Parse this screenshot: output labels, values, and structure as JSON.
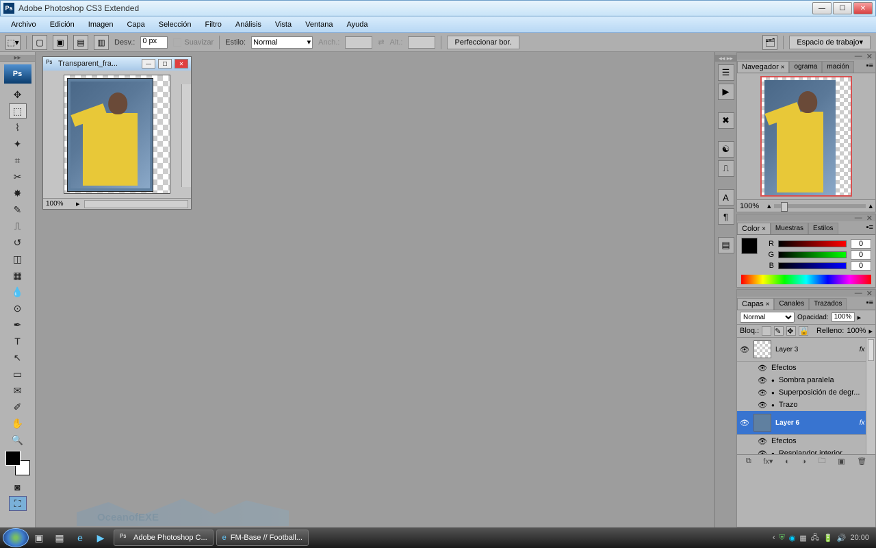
{
  "title": "Adobe Photoshop CS3 Extended",
  "menu": [
    "Archivo",
    "Edición",
    "Imagen",
    "Capa",
    "Selección",
    "Filtro",
    "Análisis",
    "Vista",
    "Ventana",
    "Ayuda"
  ],
  "optbar": {
    "desv_lbl": "Desv.:",
    "desv_val": "0 px",
    "suavizar": "Suavizar",
    "estilo_lbl": "Estilo:",
    "estilo_val": "Normal",
    "anch": "Anch.:",
    "alt": "Alt.:",
    "perf": "Perfeccionar bor.",
    "workspace": "Espacio de trabajo"
  },
  "doc": {
    "title": "Transparent_fra...",
    "zoom": "100%"
  },
  "nav_panel": {
    "tabs": [
      "Navegador",
      "ograma",
      "mación"
    ],
    "zoom": "100%"
  },
  "color_panel": {
    "tabs": [
      "Color",
      "Muestras",
      "Estilos"
    ],
    "r": "R",
    "g": "G",
    "b": "B",
    "r_val": "0",
    "g_val": "0",
    "b_val": "0"
  },
  "layers_panel": {
    "tabs": [
      "Capas",
      "Canales",
      "Trazados"
    ],
    "blend": "Normal",
    "opac_lbl": "Opacidad:",
    "opac": "100%",
    "lock_lbl": "Bloq.:",
    "fill_lbl": "Relleno:",
    "fill": "100%",
    "layer3": "Layer 3",
    "layer6": "Layer 6",
    "efectos": "Efectos",
    "sombra": "Sombra paralela",
    "superp": "Superposición de degr...",
    "trazo": "Trazo",
    "resplandor": "Resplandor interior",
    "fx": "fx"
  },
  "taskbar": {
    "task1": "Adobe Photoshop C...",
    "task2": "FM-Base // Football...",
    "time": "20:00"
  },
  "watermark": "OceanofEXE"
}
